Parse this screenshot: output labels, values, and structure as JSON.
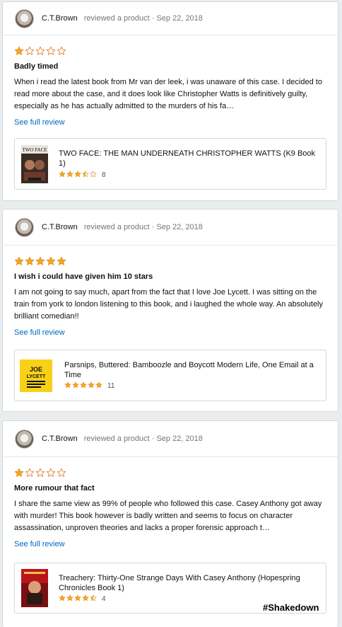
{
  "reviews": [
    {
      "reviewer": "C.T.Brown",
      "meta": "reviewed a product · Sep 22, 2018",
      "rating": 1,
      "title": "Badly timed",
      "text": "When i read the latest book from Mr van der leek, i was unaware of this case. I decided to read more about the case, and it does look like Christopher Watts is definitively guilty, especially as he has actually admitted to the murders of his fa…",
      "see_full": "See full review",
      "product": {
        "title": "TWO FACE: THE MAN UNDERNEATH CHRISTOPHER WATTS (K9 Book 1)",
        "rating": 3.5,
        "count": "8",
        "cover_text": "TWO FACE",
        "cover_icon": "book-cover-two-face"
      }
    },
    {
      "reviewer": "C.T.Brown",
      "meta": "reviewed a product · Sep 22, 2018",
      "rating": 5,
      "title": "I wish i could have given him 10 stars",
      "text": "I am not going to say much, apart from the fact that I love Joe Lycett. I was sitting on the train from york to london listening to this book, and i laughed the whole way. An absolutely brilliant comedian!!",
      "see_full": "See full review",
      "product": {
        "title": "Parsnips, Buttered: Bamboozle and Boycott Modern Life, One Email at a Time",
        "rating": 5,
        "count": "11",
        "cover_text": "JOE LYCETT",
        "cover_icon": "book-cover-parsnips-buttered"
      }
    },
    {
      "reviewer": "C.T.Brown",
      "meta": "reviewed a product · Sep 22, 2018",
      "rating": 1,
      "title": "More rumour that fact",
      "text": "I share the same view as 99% of people who followed this case. Casey Anthony got away with murder! This book however is badly written and seems to focus on character assassination, unproven theories and lacks a proper forensic approach t…",
      "see_full": "See full review",
      "product": {
        "title": "Treachery: Thirty-One Strange Days With Casey Anthony (Hopespring Chronicles Book 1)",
        "rating": 4.5,
        "count": "4",
        "cover_text": "",
        "cover_icon": "book-cover-treachery"
      }
    }
  ],
  "watermark": "#Shakedown",
  "colors": {
    "star": "#ffa41c",
    "star_empty_stroke": "#de7921",
    "link": "#0066c0",
    "meta": "#767676"
  }
}
